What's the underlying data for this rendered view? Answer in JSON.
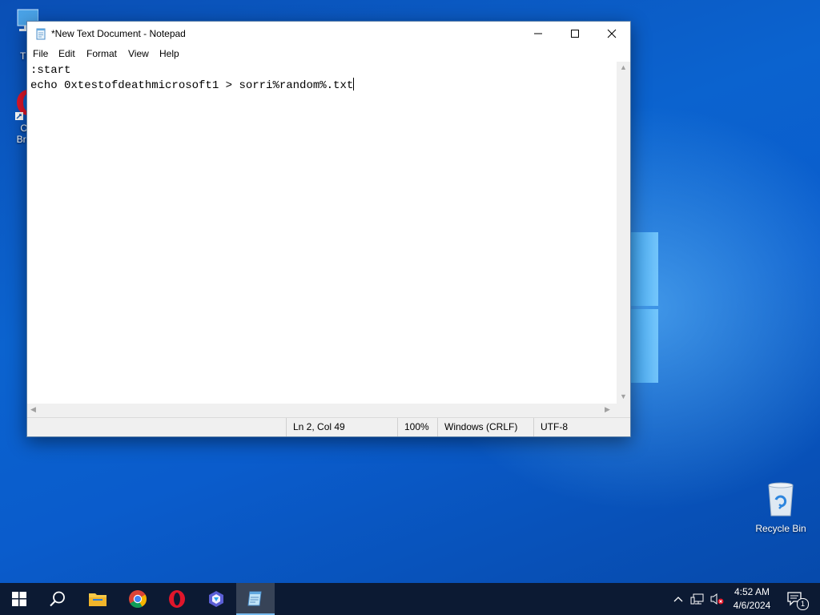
{
  "desktop": {
    "icons": [
      {
        "label": "Th",
        "icon": "this-pc-icon"
      },
      {
        "label": "O",
        "label2": "Bro",
        "icon": "opera-browser-icon"
      },
      {
        "label": "Recycle Bin",
        "icon": "recycle-bin-icon"
      }
    ]
  },
  "notepad": {
    "title": "*New Text Document - Notepad",
    "menu": [
      "File",
      "Edit",
      "Format",
      "View",
      "Help"
    ],
    "content_lines": [
      ":start",
      "echo 0xtestofdeathmicrosoft1 > sorri%random%.txt"
    ],
    "status": {
      "position": "Ln 2, Col 49",
      "zoom": "100%",
      "line_ending": "Windows (CRLF)",
      "encoding": "UTF-8"
    }
  },
  "taskbar": {
    "items": [
      "start-button",
      "search-button",
      "file-explorer",
      "chrome",
      "opera",
      "copilot",
      "notepad"
    ],
    "active": "notepad",
    "clock": {
      "time": "4:52 AM",
      "date": "4/6/2024"
    },
    "notification_count": "1"
  },
  "colors": {
    "desktop_blue": "#0b63cf",
    "taskbar": "#0c1a33",
    "active_indicator": "#76b9ed"
  }
}
